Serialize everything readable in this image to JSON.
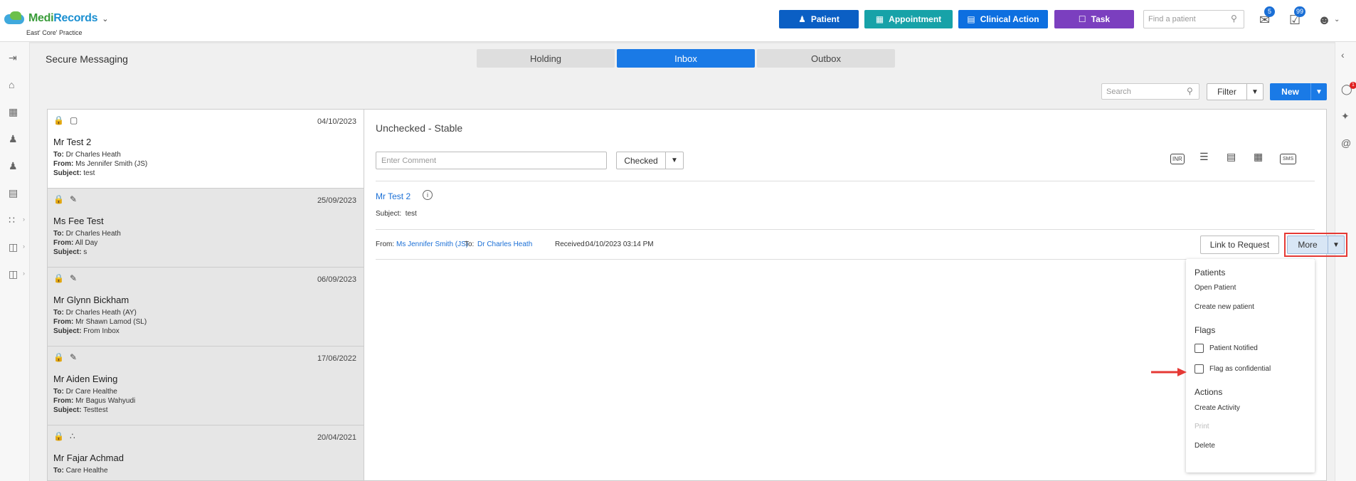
{
  "header": {
    "logo": {
      "medi": "Medi",
      "records": "Records"
    },
    "practice": "East' Core' Practice",
    "buttons": {
      "patient": "Patient",
      "appointment": "Appointment",
      "clinical_action": "Clinical Action",
      "task": "Task"
    },
    "find_placeholder": "Find a patient",
    "mail_badge": "5",
    "tasks_badge": "99"
  },
  "page": {
    "title": "Secure Messaging",
    "tabs": [
      {
        "label": "Holding"
      },
      {
        "label": "Inbox"
      },
      {
        "label": "Outbox"
      }
    ],
    "search_placeholder": "Search",
    "filter_label": "Filter",
    "new_label": "New"
  },
  "labels": {
    "to": "To:",
    "from": "From:",
    "subject": "Subject:",
    "received": "Received:"
  },
  "messages": [
    {
      "date": "04/10/2023",
      "name": "Mr Test 2",
      "to": "Dr Charles Heath",
      "from": "Ms Jennifer Smith (JS)",
      "subject": "test"
    },
    {
      "date": "25/09/2023",
      "name": "Ms Fee Test",
      "to": "Dr Charles Heath",
      "from": "All Day",
      "subject": "s"
    },
    {
      "date": "06/09/2023",
      "name": "Mr Glynn Bickham",
      "to": "Dr Charles Heath (AY)",
      "from": "Mr Shawn Lamod (SL)",
      "subject": "From Inbox"
    },
    {
      "date": "17/06/2022",
      "name": "Mr Aiden Ewing",
      "to": "Dr Care Healthe",
      "from": "Mr Bagus Wahyudi",
      "subject": "Testtest"
    },
    {
      "date": "20/04/2021",
      "name": "Mr Fajar Achmad",
      "to": "Care Healthe",
      "from": "",
      "subject": ""
    }
  ],
  "detail": {
    "status": "Unchecked - Stable",
    "comment_placeholder": "Enter Comment",
    "checked_label": "Checked",
    "tool_inr": "INR",
    "tool_sms": "SMS",
    "patient_name": "Mr Test 2",
    "subject": "test",
    "from": "Ms Jennifer Smith (JS)",
    "to": "Dr Charles Heath",
    "received": "04/10/2023 03:14 PM",
    "link_to_request": "Link to Request",
    "more": "More"
  },
  "more_menu": {
    "patients_heading": "Patients",
    "open_patient": "Open Patient",
    "create_new_patient": "Create new patient",
    "flags_heading": "Flags",
    "patient_notified": "Patient Notified",
    "flag_confidential": "Flag as confidential",
    "actions_heading": "Actions",
    "create_activity": "Create Activity",
    "print": "Print",
    "delete": "Delete"
  },
  "colors": {
    "primary": "#1a7ae6",
    "patient": "#0b5fc4",
    "appointment": "#17a2a8",
    "task": "#7b3fbf",
    "highlight": "#e53935"
  }
}
